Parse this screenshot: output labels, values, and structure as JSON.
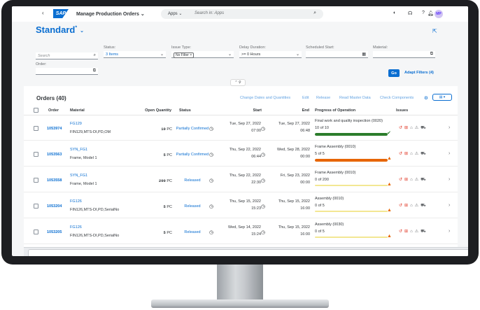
{
  "shell": {
    "back": "‹",
    "logo": "SAP",
    "title": "Manage Production Orders",
    "title_chevron": "⌄",
    "search_scope": "Apps ⌄",
    "search_placeholder": "Search in: Apps",
    "avatar": "MP"
  },
  "variant": {
    "name": "Standard",
    "marker": "*"
  },
  "filters": {
    "search_placeholder": "Search",
    "status_label": "Status:",
    "status_value": "3 Items",
    "issue_label": "Issue Type:",
    "issue_token": "No Filter ×",
    "delay_label": "Delay Duration:",
    "delay_value": ">= 0 Hours",
    "sched_label": "Scheduled Start:",
    "material_label": "Material:",
    "order_label": "Order:",
    "go": "Go",
    "adapt": "Adapt Filters (4)"
  },
  "table": {
    "title": "Orders (40)",
    "toolbar": [
      "Change Dates and Quantities",
      "Edit",
      "Release",
      "Read Master Data",
      "Check Components"
    ],
    "columns": {
      "order": "Order",
      "material": "Material",
      "open_qty": "Open Quantity",
      "status": "Status",
      "start": "Start",
      "end": "End",
      "progress": "Progress of Operation",
      "issues": "Issues"
    },
    "rows": [
      {
        "order": "1053974",
        "material": "FG129",
        "material_desc": "FIN129,MTS-DI,PD,OM",
        "qty": "10",
        "unit": "PC",
        "status": "Partially Confirmed",
        "start_date": "Tue, Sep 27, 2022",
        "start_time": "07:00",
        "end_date": "Tue, Sep 27, 2022",
        "end_time": "06:48",
        "op": "Final work and quality inspection (0020)",
        "op_count": "10 of 10",
        "progress": 1.0,
        "bar_color": "#2b7d2b",
        "badge": "✔",
        "badge_color": "#2b7d2b"
      },
      {
        "order": "1053563",
        "material": "SYN_FG1",
        "material_desc": "Frame, Model 1",
        "qty": "5",
        "unit": "PC",
        "status": "Partially Confirmed",
        "start_date": "Thu, Sep 22, 2022",
        "start_time": "06:44",
        "end_date": "Wed, Sep 28, 2022",
        "end_time": "00:00",
        "op": "Frame Assembly (0010)",
        "op_count": "5 of 5",
        "progress": 1.0,
        "bar_color": "#e76500",
        "badge": "▲",
        "badge_color": "#e76500"
      },
      {
        "order": "1053558",
        "material": "SYN_FG1",
        "material_desc": "Frame, Model 1",
        "qty": "200",
        "unit": "PC",
        "status": "Released",
        "start_date": "Thu, Sep 22, 2022",
        "start_time": "22:30",
        "end_date": "Fri, Sep 23, 2022",
        "end_time": "00:00",
        "op": "Frame Assembly (0010)",
        "op_count": "0 of 200",
        "progress": 0.0,
        "bar_color": "#e9d43b",
        "badge": "▲",
        "badge_color": "#e76500"
      },
      {
        "order": "1053204",
        "material": "FG126",
        "material_desc": "FIN126,MTS-DI,PD,SerialNo",
        "qty": "5",
        "unit": "PC",
        "status": "Released",
        "start_date": "Thu, Sep 15, 2022",
        "start_time": "15:23",
        "end_date": "Thu, Sep 15, 2022",
        "end_time": "16:00",
        "op": "Assembly (0010)",
        "op_count": "0 of 5",
        "progress": 0.0,
        "bar_color": "#e9d43b",
        "badge": "▲",
        "badge_color": "#e76500"
      },
      {
        "order": "1053205",
        "material": "FG126",
        "material_desc": "FIN126,MTS-DI,PD,SerialNo",
        "qty": "5",
        "unit": "PC",
        "status": "Released",
        "start_date": "Wed, Sep 14, 2022",
        "start_time": "15:24",
        "end_date": "Thu, Sep 15, 2022",
        "end_time": "16:00",
        "op": "Assembly (0030)",
        "op_count": "0 of 5",
        "progress": 0.0,
        "bar_color": "#e9d43b",
        "badge": "▲",
        "badge_color": "#e76500"
      }
    ]
  },
  "colors": {
    "accent": "#0a6ed1",
    "error": "#e0301e",
    "success": "#2b7d2b",
    "warning": "#e76500"
  }
}
